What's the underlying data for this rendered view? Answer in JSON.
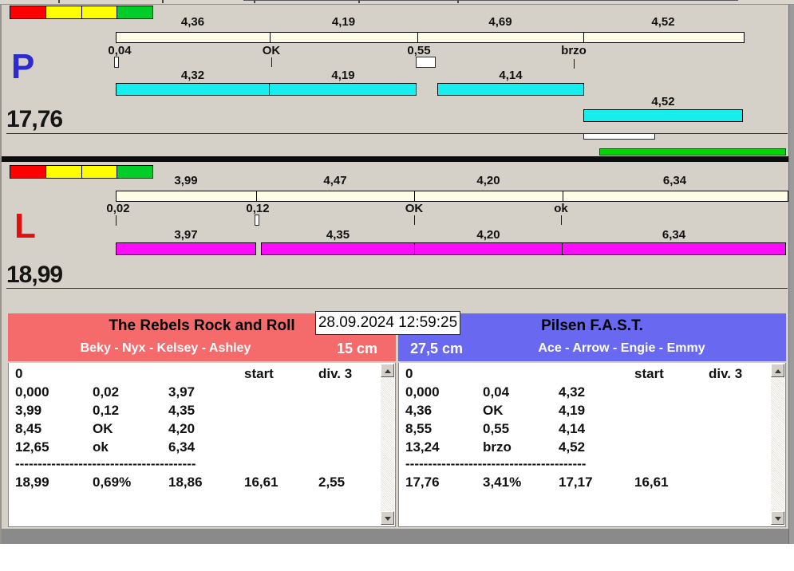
{
  "timestamp": "28.09.2024 12:59:25",
  "lanes": {
    "p": {
      "letter": "P",
      "total": "17,76",
      "timeline_segments": [
        "4,36",
        "4,19",
        "4,69",
        "4,52"
      ],
      "marks": [
        "0,04",
        "OK",
        "0,55",
        "brzo"
      ],
      "splits": [
        "4,32",
        "4,19",
        "4,14"
      ],
      "extra_split": "4,52"
    },
    "l": {
      "letter": "L",
      "total": "18,99",
      "timeline_segments": [
        "3,99",
        "4,47",
        "4,20",
        "6,34"
      ],
      "marks": [
        "0,02",
        "0,12",
        "OK",
        "ok"
      ],
      "splits": [
        "3,97",
        "4,35",
        "4,20",
        "6,34"
      ]
    }
  },
  "teams": {
    "left": {
      "name": "The Rebels Rock and Roll",
      "dogs": "Beky - Nyx - Kelsey - Ashley",
      "jump_height": "15 cm",
      "table": {
        "header": {
          "lead": "0",
          "start": "start",
          "division": "div. 3"
        },
        "rows": [
          [
            "0,000",
            "0,02",
            "3,97"
          ],
          [
            "3,99",
            "0,12",
            "4,35"
          ],
          [
            "8,45",
            "OK",
            "4,20"
          ],
          [
            "12,65",
            "ok",
            "6,34"
          ]
        ],
        "separator": "----------------------------------------",
        "summary": [
          "18,99",
          "0,69%",
          "18,86",
          "16,61",
          "2,55"
        ]
      }
    },
    "right": {
      "name": "Pilsen F.A.S.T.",
      "dogs": "Ace - Arrow - Engie - Emmy",
      "jump_height": "27,5 cm",
      "table": {
        "header": {
          "lead": "0",
          "start": "start",
          "division": "div. 3"
        },
        "rows": [
          [
            "0,000",
            "0,04",
            "4,32"
          ],
          [
            "4,36",
            "OK",
            "4,19"
          ],
          [
            "8,55",
            "0,55",
            "4,14"
          ],
          [
            "13,24",
            "brzo",
            "4,52"
          ]
        ],
        "separator": "----------------------------------------",
        "summary": [
          "17,76",
          "3,41%",
          "17,17",
          "16,61"
        ]
      }
    }
  },
  "colors": {
    "background": "#d5d1c8",
    "lane_p_letter": "#2b2bd0",
    "lane_l_letter": "#e01010",
    "timeline_bar": "#fdfce7",
    "split_bar_p": "#17eded",
    "split_bar_l": "#fb0cfb",
    "progress_green": "#00d800",
    "team_left_header": "#f56b6b",
    "team_right_header": "#6868f0",
    "light_red": "#ff0000",
    "light_yellow": "#ffff00",
    "light_green": "#00cc2a"
  }
}
